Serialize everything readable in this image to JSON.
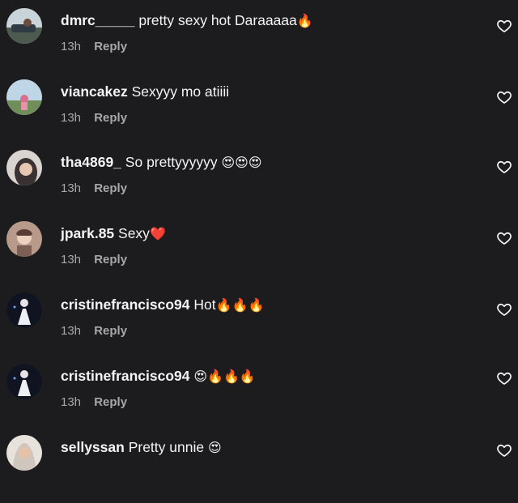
{
  "comments": [
    {
      "username": "dmrc_____",
      "text": "pretty sexy hot Daraaaaa",
      "emoji": "🔥",
      "time": "13h",
      "reply": "Reply"
    },
    {
      "username": "viancakez",
      "text": "Sexyyy mo atiiii",
      "emoji": "",
      "time": "13h",
      "reply": "Reply"
    },
    {
      "username": "tha4869_",
      "text": "So prettyyyyyy",
      "emoji": "😍😍😍",
      "time": "13h",
      "reply": "Reply"
    },
    {
      "username": "jpark.85",
      "text": "Sexy",
      "emoji": "❤️",
      "time": "13h",
      "reply": "Reply"
    },
    {
      "username": "cristinefrancisco94",
      "text": "Hot",
      "emoji": "🔥🔥🔥",
      "time": "13h",
      "reply": "Reply"
    },
    {
      "username": "cristinefrancisco94",
      "text": "",
      "emoji": "😍🔥🔥🔥",
      "time": "13h",
      "reply": "Reply"
    },
    {
      "username": "sellyssan",
      "text": "Pretty unnie",
      "emoji": "😍",
      "time": "",
      "reply": ""
    }
  ],
  "icons": {
    "like": "heart-outline-icon"
  },
  "colors": {
    "background": "#1c1c1e",
    "primary_text": "#f5f5f5",
    "secondary_text": "#a8a8a8"
  }
}
